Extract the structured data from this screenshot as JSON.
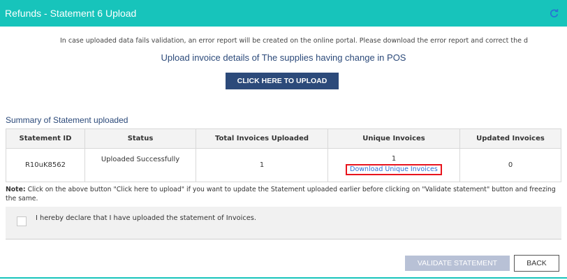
{
  "header": {
    "title": "Refunds - Statement 6 Upload",
    "refresh_icon": "refresh-icon"
  },
  "info_text": "In case uploaded data fails validation, an error report will be created on the online portal. Please download the error report and correct the d",
  "upload": {
    "title": "Upload invoice details of The supplies having change in POS",
    "button_label": "CLICK HERE TO UPLOAD"
  },
  "summary": {
    "title": "Summary of Statement uploaded",
    "columns": [
      "Statement ID",
      "Status",
      "Total Invoices Uploaded",
      "Unique Invoices",
      "Updated Invoices"
    ],
    "row": {
      "statement_id": "R10uK8562",
      "status": "Uploaded Successfully",
      "total_invoices": "1",
      "unique_invoices": "1",
      "download_link": "Download Unique Invoices",
      "updated_invoices": "0"
    }
  },
  "note": {
    "label": "Note:",
    "text": " Click on the above button \"Click here to upload\" if you want to update the Statement uploaded earlier before clicking on \"Validate statement\" button and freezing the same."
  },
  "declaration": "I hereby declare that I have uploaded the statement of Invoices.",
  "buttons": {
    "validate": "VALIDATE STATEMENT",
    "back": "BACK"
  },
  "colors": {
    "header": "#17c4bb",
    "primary": "#2c4a7a",
    "link": "#2a6fd6",
    "highlight": "#e8141d",
    "disabled": "#b8c1d6"
  }
}
